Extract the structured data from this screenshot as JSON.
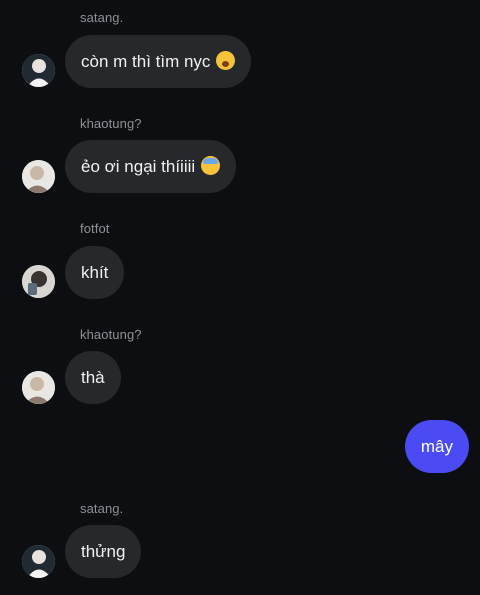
{
  "messages": [
    {
      "sender": "satang.",
      "text": "còn m thì tìm nyc",
      "emoji": "face-screaming-emoji",
      "avatar": "avatar-satang"
    },
    {
      "sender": "khaotung?",
      "text": "ẻo ơi ngại thíiiii",
      "emoji": "face-sweat-emoji",
      "avatar": "avatar-khaotung"
    },
    {
      "sender": "fotfot",
      "text": "khít",
      "avatar": "avatar-fotfot"
    },
    {
      "sender": "khaotung?",
      "text": "thà",
      "avatar": "avatar-khaotung"
    },
    {
      "self": true,
      "text": "mây"
    },
    {
      "sender": "satang.",
      "text": "thửng",
      "avatar": "avatar-satang"
    }
  ],
  "colors": {
    "background": "#0d0e11",
    "incoming_bubble": "#26282c",
    "outgoing_bubble": "#4a4bf2",
    "sender_name": "#8e9096"
  }
}
